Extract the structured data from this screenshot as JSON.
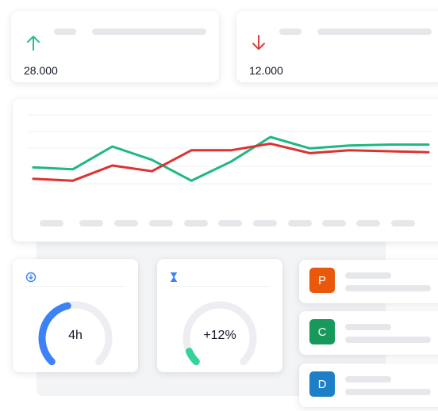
{
  "stats": [
    {
      "value": "28.000",
      "direction": "up",
      "color": "#2dbd8a",
      "icon": "arrow-up-icon"
    },
    {
      "value": "12.000",
      "direction": "down",
      "color": "#e03b3b",
      "icon": "arrow-down-icon"
    }
  ],
  "chart_data": {
    "type": "line",
    "x": [
      0,
      1,
      2,
      3,
      4,
      5,
      6,
      7,
      8,
      9,
      10
    ],
    "series": [
      {
        "color": "#1fb784",
        "values": [
          62,
          64,
          40,
          54,
          76,
          56,
          30,
          42,
          39,
          38,
          38
        ]
      },
      {
        "color": "#dc3232",
        "values": [
          74,
          76,
          60,
          66,
          44,
          44,
          37,
          47,
          44,
          45,
          46
        ]
      }
    ],
    "ylim": [
      0,
      100
    ],
    "grid": true,
    "legend": "none",
    "xlabels_visible": false
  },
  "gauges": [
    {
      "value": "4h",
      "fraction": 0.45,
      "color": "#3b82f6",
      "icon": "download-icon"
    },
    {
      "value": "+12%",
      "fraction": 0.08,
      "color": "#34d399",
      "icon": "hourglass-icon"
    }
  ],
  "list": [
    {
      "letter": "P",
      "color": "#ea580c"
    },
    {
      "letter": "C",
      "color": "#16995a"
    },
    {
      "letter": "D",
      "color": "#1d7fc6"
    }
  ]
}
